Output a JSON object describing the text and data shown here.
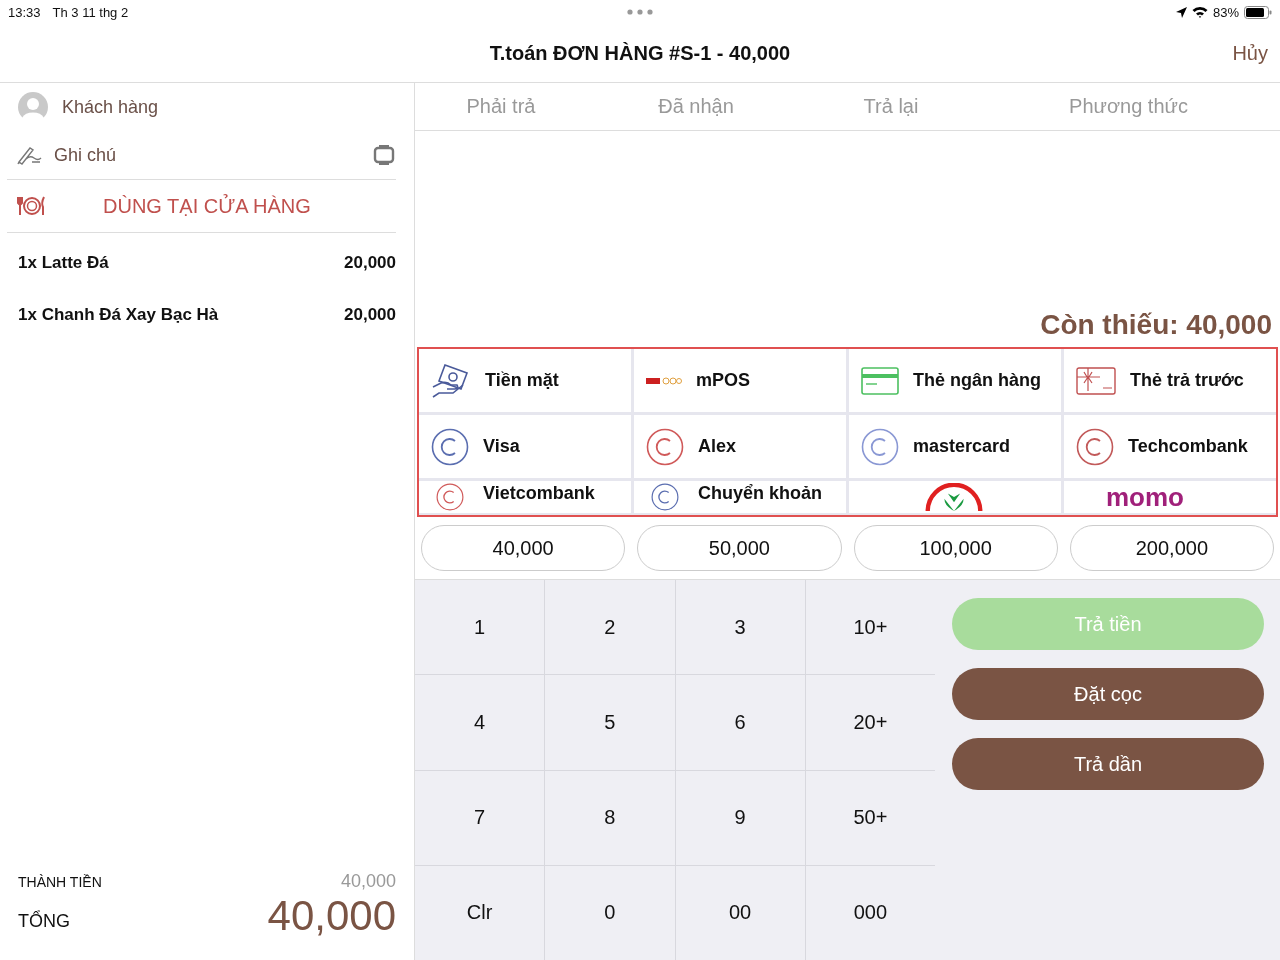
{
  "status_bar": {
    "time": "13:33",
    "date": "Th 3 11 thg 2",
    "battery": "83%"
  },
  "header": {
    "title": "T.toán ĐƠN HÀNG #S-1 - 40,000",
    "cancel": "Hủy"
  },
  "order": {
    "customer": "Khách hàng",
    "note": "Ghi chú",
    "dine_mode": "DÙNG TẠI CỬA HÀNG",
    "items": [
      {
        "name": "1x Latte Đá",
        "price": "20,000"
      },
      {
        "name": "1x Chanh Đá Xay Bạc Hà",
        "price": "20,000"
      }
    ],
    "subtotal_label": "THÀNH TIỀN",
    "subtotal": "40,000",
    "total_label": "TỔNG",
    "total": "40,000"
  },
  "payments_table": {
    "columns": [
      "Phải trả",
      "Đã nhận",
      "Trả lại",
      "Phương thức"
    ]
  },
  "remaining": "Còn thiếu: 40,000",
  "payment_methods": [
    {
      "kind": "cash",
      "label": "Tiền mặt"
    },
    {
      "kind": "mpos",
      "label": "mPOS"
    },
    {
      "kind": "bank-card",
      "label": "Thẻ ngân hàng"
    },
    {
      "kind": "prepaid",
      "label": "Thẻ trả trước"
    },
    {
      "kind": "circle",
      "label": "Visa",
      "color": "#5b6eb0"
    },
    {
      "kind": "circle",
      "label": "Alex",
      "color": "#d05a5a"
    },
    {
      "kind": "circle",
      "label": "mastercard",
      "color": "#8a98d4"
    },
    {
      "kind": "circle",
      "label": "Techcombank",
      "color": "#c25a5a"
    },
    {
      "kind": "circle",
      "label": "Vietcombank",
      "color": "#d05a5a"
    },
    {
      "kind": "circle",
      "label": "Chuyển khoản",
      "color": "#5b6eb0"
    },
    {
      "kind": "leaf-logo"
    },
    {
      "kind": "word-logo",
      "label": "momo"
    }
  ],
  "quick_amounts": [
    "40,000",
    "50,000",
    "100,000",
    "200,000"
  ],
  "keypad": [
    "1",
    "2",
    "3",
    "10+",
    "4",
    "5",
    "6",
    "20+",
    "7",
    "8",
    "9",
    "50+",
    "Clr",
    "0",
    "00",
    "000"
  ],
  "actions": [
    {
      "label": "Trả tiền",
      "disabled": true
    },
    {
      "label": "Đặt cọc",
      "disabled": false
    },
    {
      "label": "Trả dần",
      "disabled": false
    }
  ]
}
